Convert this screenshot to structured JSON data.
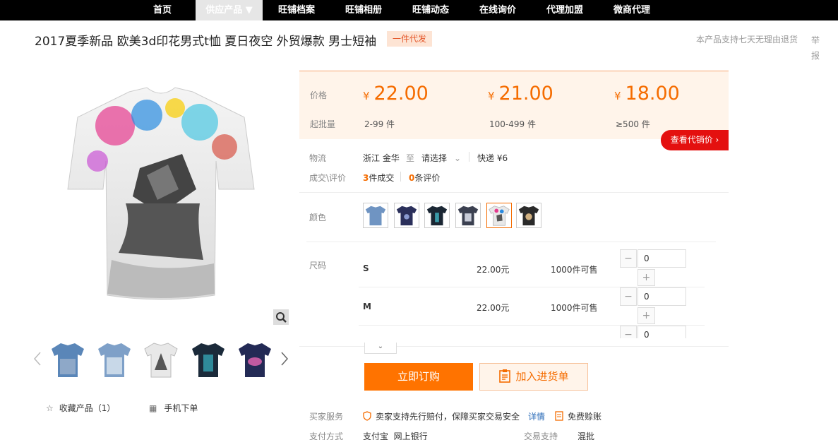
{
  "nav": {
    "items": [
      "首页",
      "供应产品 ▼",
      "旺铺档案",
      "旺铺相册",
      "旺铺动态",
      "在线询价",
      "代理加盟",
      "微商代理"
    ]
  },
  "product": {
    "title": "2017夏季新品 欧美3d印花男式t恤 夏日夜空 外贸爆款 男士短袖",
    "badge": "一件代发",
    "return_note": "本产品支持七天无理由退货",
    "report": "举报"
  },
  "gallery": {
    "favorite": "收藏产品（1）",
    "mobile_order": "手机下单"
  },
  "price": {
    "price_label": "价格",
    "qty_label": "起批量",
    "currency": "¥",
    "tiers": [
      {
        "price": "22.00",
        "qty": "2-99 件"
      },
      {
        "price": "21.00",
        "qty": "100-499 件"
      },
      {
        "price": "18.00",
        "qty": "≥500 件"
      }
    ],
    "agent_button": "查看代销价 ›"
  },
  "logistics": {
    "label": "物流",
    "from": "浙江 金华",
    "to_word": "至",
    "select": "请选择",
    "express": "快递 ¥6"
  },
  "deals": {
    "label": "成交\\评价",
    "count": "3",
    "count_suffix": "件成交",
    "reviews": "0",
    "reviews_suffix": "条评价"
  },
  "color": {
    "label": "颜色"
  },
  "size": {
    "label": "尺码",
    "rows": [
      {
        "name": "S",
        "price": "22.00元",
        "stock": "1000件可售",
        "qty": "0"
      },
      {
        "name": "M",
        "price": "22.00元",
        "stock": "1000件可售",
        "qty": "0"
      }
    ],
    "partial_qty": "0"
  },
  "actions": {
    "buy": "立即订购",
    "cart": "加入进货单"
  },
  "service": {
    "label": "买家服务",
    "guarantee": "卖家支持先行赔付，保障买家交易安全",
    "details": "详情",
    "free_invoice": "免费赊账"
  },
  "payment": {
    "label": "支付方式",
    "methods": "支付宝  网上银行",
    "trade_label": "交易支持",
    "trade_value": "混批"
  },
  "colors": {
    "accent": "#f56c00",
    "red": "#e4100f"
  }
}
